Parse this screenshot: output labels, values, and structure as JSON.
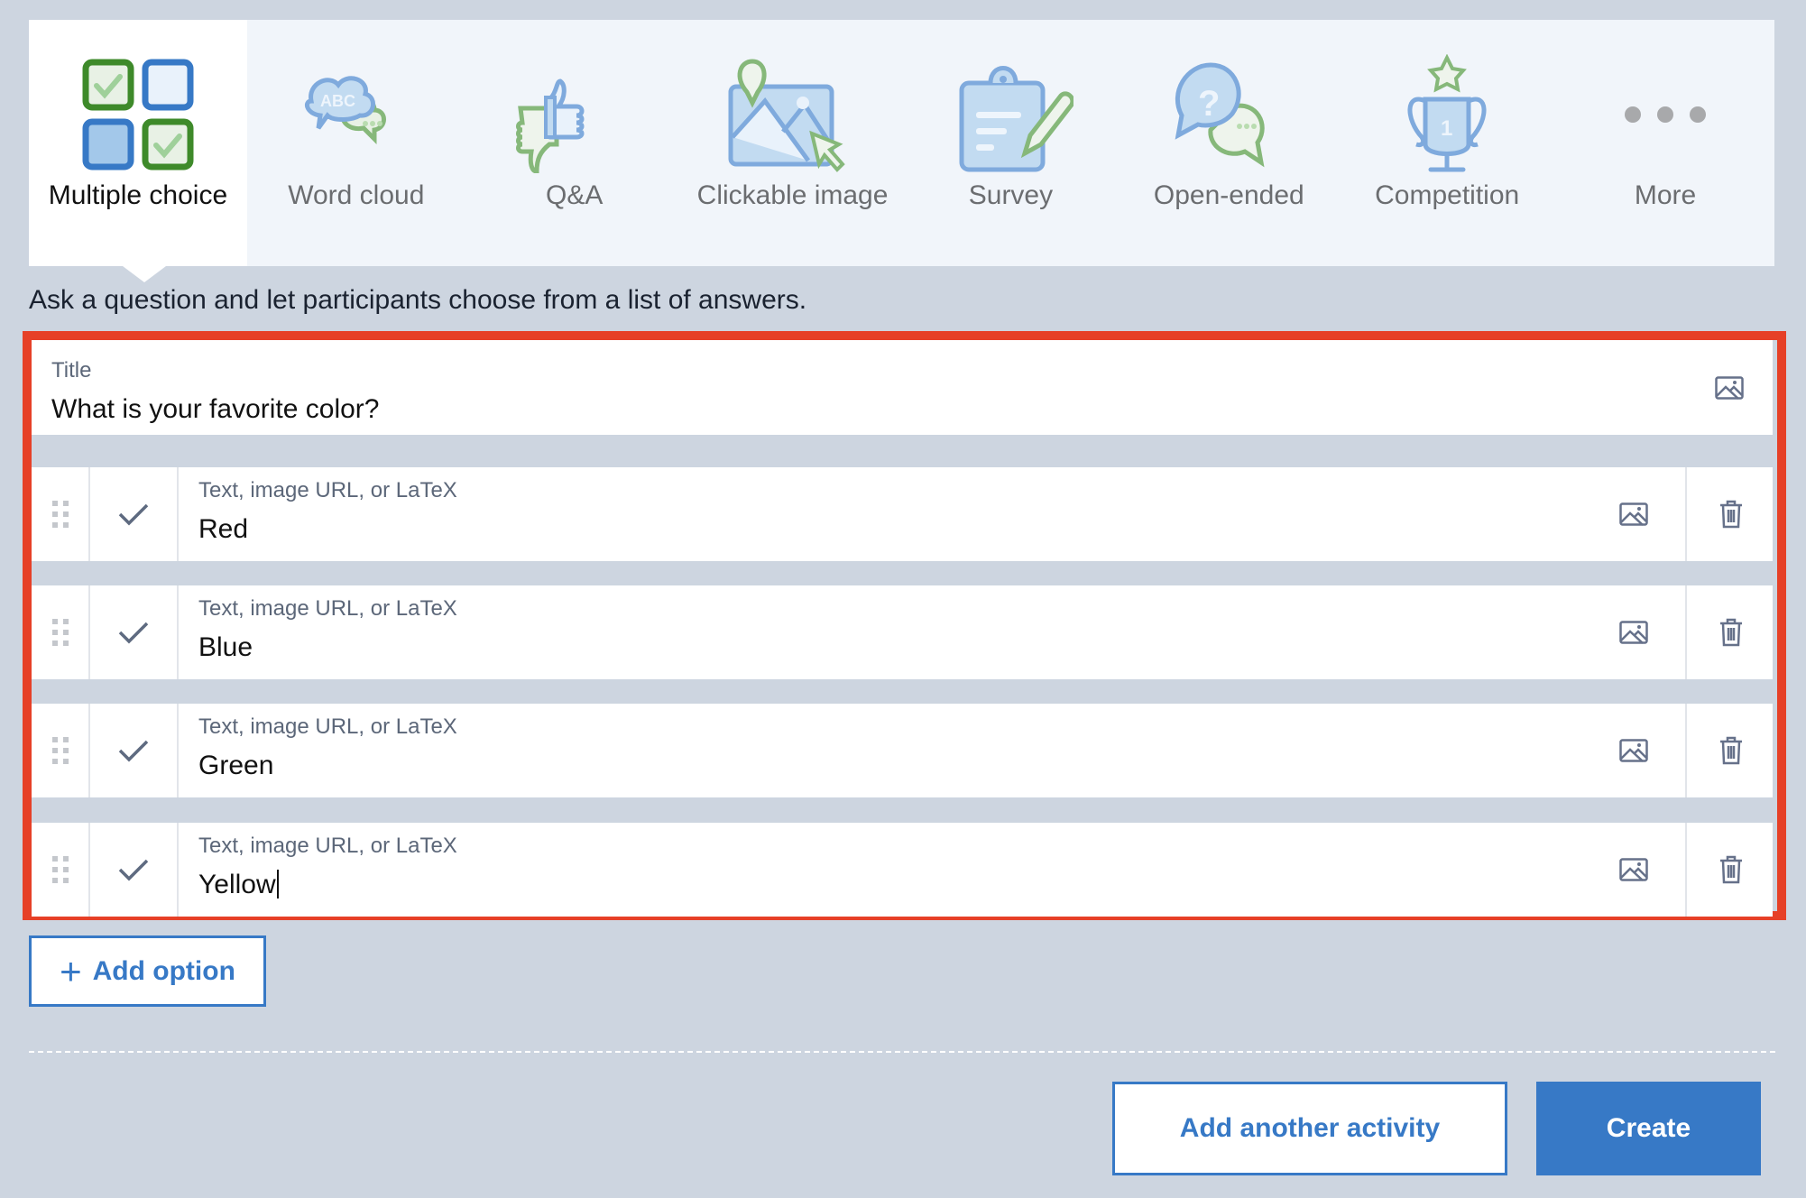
{
  "tabs": [
    {
      "label": "Multiple choice",
      "icon": "multiple-choice-icon",
      "active": true
    },
    {
      "label": "Word cloud",
      "icon": "word-cloud-icon",
      "active": false
    },
    {
      "label": "Q&A",
      "icon": "thumbs-up-down-icon",
      "active": false
    },
    {
      "label": "Clickable image",
      "icon": "clickable-image-icon",
      "active": false
    },
    {
      "label": "Survey",
      "icon": "clipboard-pencil-icon",
      "active": false
    },
    {
      "label": "Open-ended",
      "icon": "question-bubbles-icon",
      "active": false
    },
    {
      "label": "Competition",
      "icon": "trophy-icon",
      "active": false
    },
    {
      "label": "More",
      "icon": "more-dots-icon",
      "active": false
    }
  ],
  "description": "Ask a question and let participants choose from a list of answers.",
  "title_field": {
    "label": "Title",
    "value": "What is your favorite color?"
  },
  "options": [
    {
      "placeholder": "Text, image URL, or LaTeX",
      "value": "Red"
    },
    {
      "placeholder": "Text, image URL, or LaTeX",
      "value": "Blue"
    },
    {
      "placeholder": "Text, image URL, or LaTeX",
      "value": "Green"
    },
    {
      "placeholder": "Text, image URL, or LaTeX",
      "value": "Yellow"
    }
  ],
  "buttons": {
    "add_option": "Add option",
    "add_another_activity": "Add another activity",
    "create": "Create"
  },
  "colors": {
    "accent": "#3779c6",
    "highlight_border": "#e64027",
    "background": "#cdd5e0",
    "tab_bar": "#f1f5fa",
    "icon_blue": "#7faadd",
    "icon_green": "#86b87a"
  }
}
